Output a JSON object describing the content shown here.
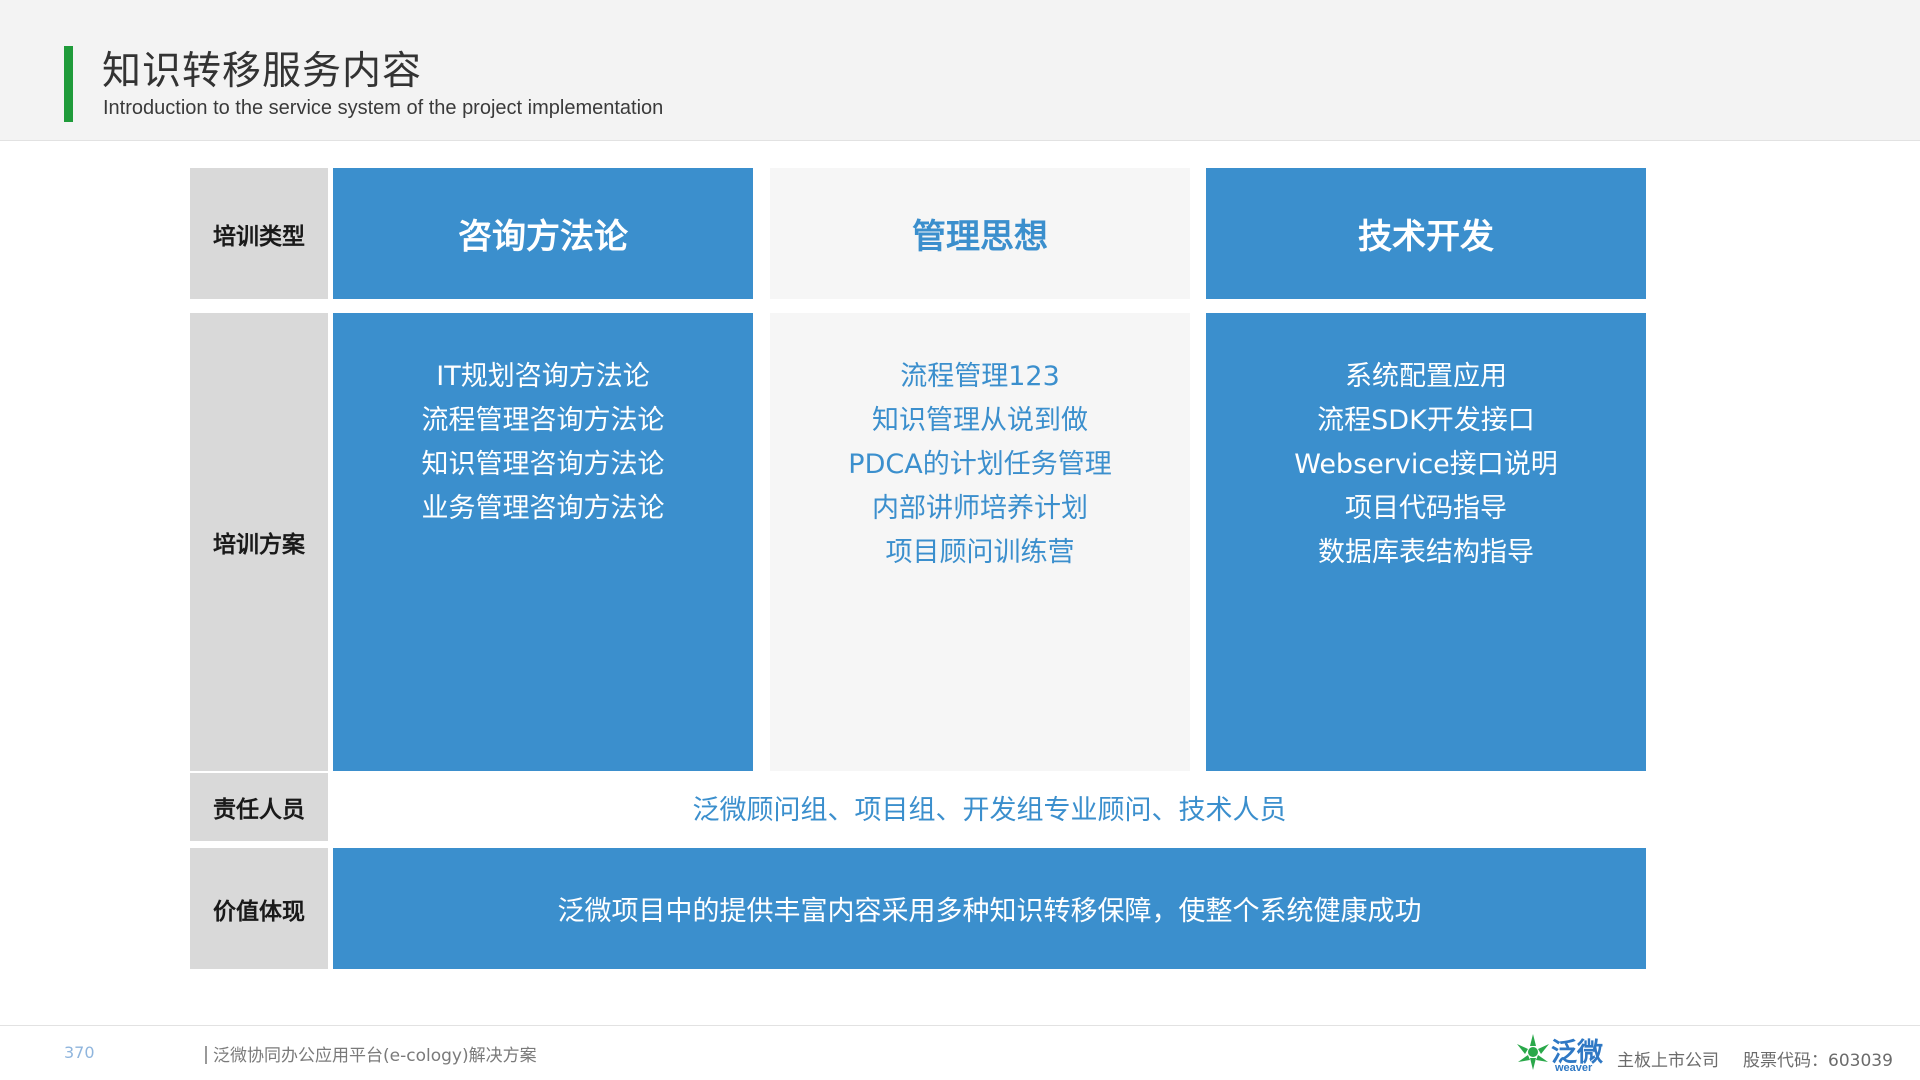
{
  "header": {
    "title": "知识转移服务内容",
    "subtitle": "Introduction to the service system of the project implementation"
  },
  "table": {
    "row_labels": {
      "type": "培训类型",
      "plan": "培训方案",
      "people": "责任人员",
      "value": "价值体现"
    },
    "columns": [
      {
        "title": "咨询方法论",
        "items": [
          "IT规划咨询方法论",
          "流程管理咨询方法论",
          "知识管理咨询方法论",
          "业务管理咨询方法论"
        ]
      },
      {
        "title": "管理思想",
        "items": [
          "流程管理123",
          "知识管理从说到做",
          "PDCA的计划任务管理",
          "内部讲师培养计划",
          "项目顾问训练营"
        ]
      },
      {
        "title": "技术开发",
        "items": [
          "系统配置应用",
          "流程SDK开发接口",
          "Webservice接口说明",
          "项目代码指导",
          "数据库表结构指导"
        ]
      }
    ],
    "people_text": "泛微顾问组、项目组、开发组专业顾问、技术人员",
    "value_text": "泛微项目中的提供丰富内容采用多种知识转移保障，使整个系统健康成功"
  },
  "footer": {
    "page_number": "370",
    "doc_title": "泛微协同办公应用平台(e-cology)解决方案",
    "logo_cn": "泛微",
    "logo_en": "weaver",
    "listed": "主板上市公司",
    "stock_code": "股票代码：603039"
  },
  "colors": {
    "accent_green": "#1f9b3a",
    "cell_blue": "#3b8fcd",
    "label_gray": "#d9d9d9",
    "light_cell": "#f6f6f6"
  }
}
